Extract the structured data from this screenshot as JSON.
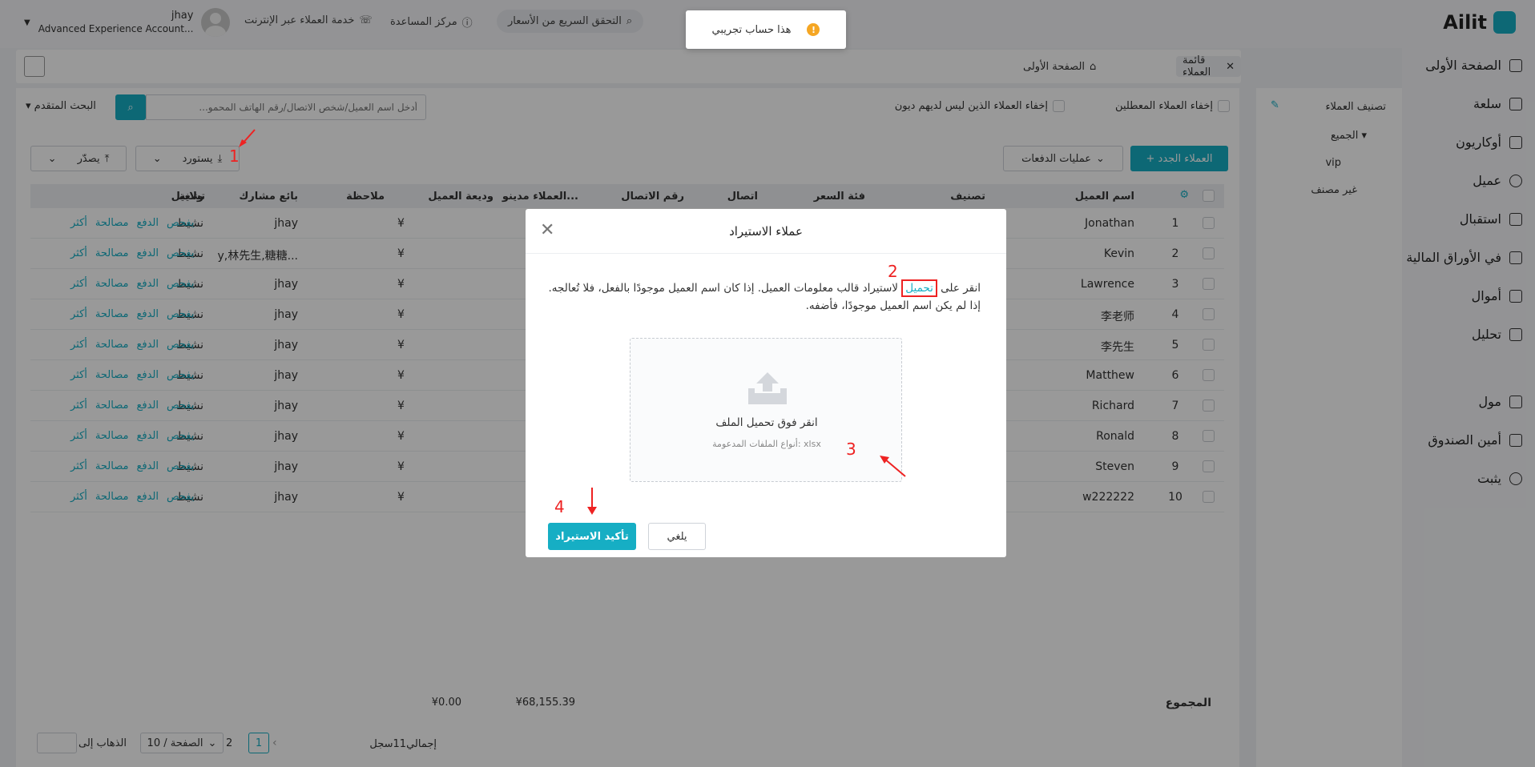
{
  "brand": {
    "name": "Ailit"
  },
  "header": {
    "quick_price": "التحقق السريع من الأسعار",
    "help_center": "مركز المساعدة",
    "online_service": "خدمة العملاء عبر الإنترنت",
    "user_name": "jhay",
    "account_type": "Advanced Experience Account..."
  },
  "toast": {
    "text": "هذا حساب تجريبي",
    "icon": "!"
  },
  "sidebar": {
    "items": [
      {
        "label": "الصفحة الأولى",
        "icon": "home-icon"
      },
      {
        "label": "سلعة",
        "icon": "bag-icon"
      },
      {
        "label": "أوكاريون",
        "icon": "document-icon"
      },
      {
        "label": "عميل",
        "icon": "user-icon"
      },
      {
        "label": "استقبال",
        "icon": "receipt-icon"
      },
      {
        "label": "في الأوراق المالية",
        "icon": "warehouse-icon"
      },
      {
        "label": "أموال",
        "icon": "folder-icon"
      },
      {
        "label": "تحليل",
        "icon": "chart-icon"
      },
      {
        "label": "مول",
        "icon": "shop-icon"
      },
      {
        "label": "أمين الصندوق",
        "icon": "monitor-icon"
      },
      {
        "label": "يثبت",
        "icon": "gear-icon"
      }
    ]
  },
  "tabs": [
    {
      "label": "الصفحة الأولى"
    },
    {
      "label": "قائمة العملاء"
    }
  ],
  "category_panel": {
    "title": "تصنيف العملاء",
    "all": "الجميع",
    "vip": "vip",
    "unclassified": "غير مصنف"
  },
  "filters": {
    "hide_disabled": "إخفاء العملاء المعطلين",
    "hide_no_debt": "إخفاء العملاء الذين ليس لديهم ديون",
    "search_placeholder": "أدخل اسم العميل/شخص الاتصال/رقم الهاتف المحمو...",
    "advanced_search": "البحث المتقدم"
  },
  "toolbar": {
    "new_customer": "+ العملاء الجدد",
    "batch_ops": "عمليات الدفعات",
    "import": "يستورد",
    "export": "يصدّر"
  },
  "table": {
    "headers": [
      "اسم العميل",
      "تصنيف",
      "فئة السعر",
      "اتصال",
      "رقم الاتصال",
      "العملاء مدينو...",
      "وديعة العميل",
      "ملاحظة",
      "بائع مشارك",
      "ولاية",
      "تشغيل"
    ],
    "rows": [
      {
        "no": "1",
        "name": "Jonathan",
        "seller": "jhay",
        "status": "نشيط"
      },
      {
        "no": "2",
        "name": "Kevin",
        "seller": "y,林先生,糖糖...",
        "status": "نشيط"
      },
      {
        "no": "3",
        "name": "Lawrence",
        "seller": "jhay",
        "status": "نشيط"
      },
      {
        "no": "4",
        "name": "李老师",
        "seller": "jhay",
        "status": "نشيط"
      },
      {
        "no": "5",
        "name": "李先生",
        "seller": "jhay",
        "status": "نشيط"
      },
      {
        "no": "6",
        "name": "Matthew",
        "seller": "jhay",
        "status": "نشيط"
      },
      {
        "no": "7",
        "name": "Richard",
        "seller": "jhay",
        "status": "نشيط"
      },
      {
        "no": "8",
        "name": "Ronald",
        "seller": "jhay",
        "status": "نشيط"
      },
      {
        "no": "9",
        "name": "Steven",
        "seller": "jhay",
        "status": "نشيط"
      },
      {
        "no": "10",
        "name": "w222222",
        "seller": "jhay",
        "status": "نشيط"
      }
    ],
    "row_prefix": "¥",
    "ops": [
      "يفحص",
      "الدفع",
      "مصالحة",
      "أكثر"
    ],
    "total_label": "المجموع",
    "total_debt": "¥68,155.39",
    "total_deposit": "¥0.00"
  },
  "pagination": {
    "total": "إجمالي11سجل",
    "pages": [
      "1",
      "2"
    ],
    "page_size": "10 / الصفحة",
    "goto": "الذهاب إلى"
  },
  "modal": {
    "title": "عملاء الاستيراد",
    "instr_before": "انقر على",
    "instr_link": "تحميل",
    "instr_after": "لاستيراد قالب معلومات العميل. إذا كان اسم العميل موجودًا بالفعل، فلا تُعالجه. إذا لم يكن اسم العميل موجودًا، فأضفه.",
    "drop_text": "انقر فوق تحميل الملف",
    "drop_hint": "أنواع الملفات المدعومة: xlsx",
    "cancel": "يلغي",
    "confirm": "تأكيد الاستيراد"
  },
  "annotations": [
    "1",
    "2",
    "3",
    "4"
  ]
}
